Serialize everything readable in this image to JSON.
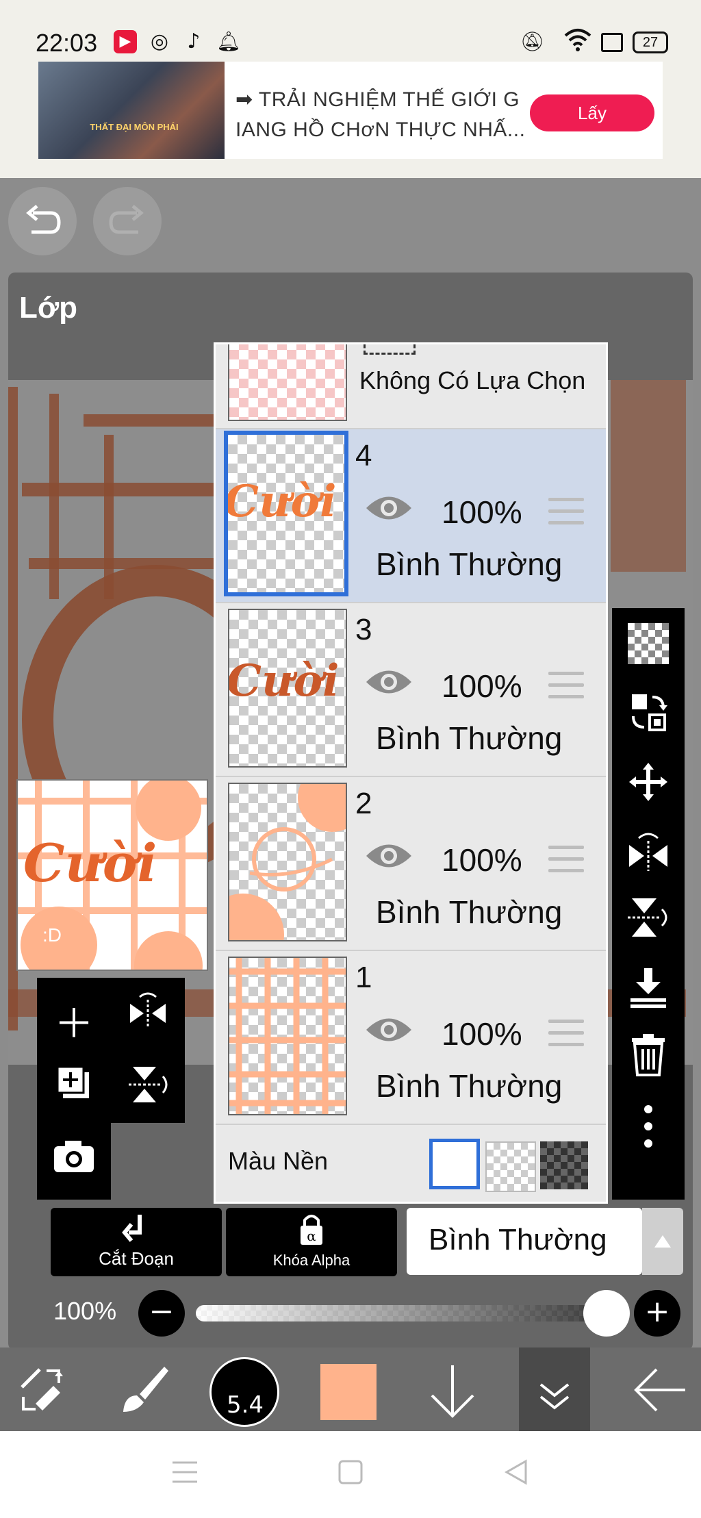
{
  "status_bar": {
    "time": "22:03",
    "battery": "27",
    "notification_icons": [
      "app-red-icon",
      "instagram-icon",
      "tiktok-icon",
      "bell-icon"
    ],
    "system_icons": [
      "mute-icon",
      "wifi-icon",
      "sim-icon",
      "battery-icon"
    ]
  },
  "ad": {
    "text_line1": "➡ TRẢI NGHIỆM THẾ GIỚI G",
    "text_line2": "IANG HỒ CHơN THỰC NHẤ...",
    "button_label": "Lấy",
    "accent": "#ef1d52",
    "image_caption": "THẤT ĐẠI MÔN PHÁI"
  },
  "history": {
    "undo_icon": "undo-icon",
    "redo_icon": "redo-icon"
  },
  "panel": {
    "title": "Lớp"
  },
  "selection_layer": {
    "label": "Không Có Lựa Chọn"
  },
  "layers": [
    {
      "number": "4",
      "opacity": "100%",
      "mode": "Bình Thường",
      "selected": true,
      "thumb_text": "Cười"
    },
    {
      "number": "3",
      "opacity": "100%",
      "mode": "Bình Thường",
      "selected": false,
      "thumb_text": "Cười"
    },
    {
      "number": "2",
      "opacity": "100%",
      "mode": "Bình Thường",
      "selected": false
    },
    {
      "number": "1",
      "opacity": "100%",
      "mode": "Bình Thường",
      "selected": false
    }
  ],
  "background": {
    "label": "Màu Nền",
    "options": [
      "white",
      "transparent",
      "dark-checker"
    ],
    "selected": "white"
  },
  "preview": {
    "text": "Cười",
    "face_text": ":D"
  },
  "controls": {
    "clip_label": "Cắt Đoạn",
    "alpha_lock_label": "Khóa Alpha",
    "blend_mode": "Bình Thường",
    "opacity_label": "100%",
    "opacity_value": 1.0
  },
  "toolbar": {
    "brush_size": "5.4",
    "current_color": "#ffb38c"
  },
  "colors": {
    "selected_border": "#2f6fd8",
    "layer_selected_bg": "#cfd9ea",
    "accent_orange": "#d76231"
  }
}
